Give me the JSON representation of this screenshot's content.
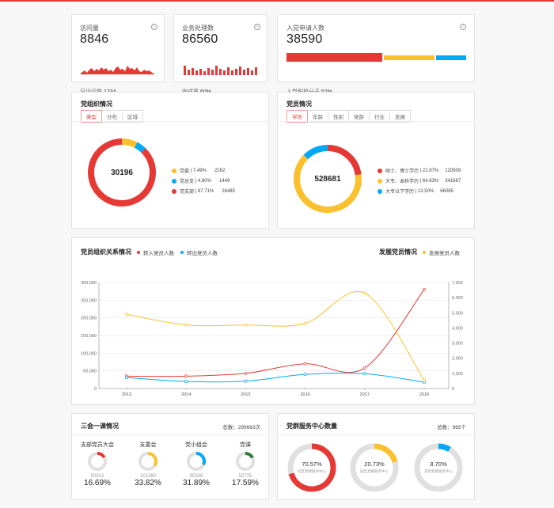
{
  "colors": {
    "red": "#e53935",
    "yellow": "#fbc02d",
    "blue": "#03a9f4",
    "green": "#2e7d32",
    "gray": "#e0e0e0"
  },
  "visits": {
    "label": "访问量",
    "value": "8846",
    "sub_label": "日访问量",
    "sub_value": "1234"
  },
  "business": {
    "label": "业务处理数",
    "value": "86560",
    "sub_label": "完成率",
    "sub_value": "60%"
  },
  "applicants": {
    "label": "入党申请人数",
    "value": "38590",
    "sub_label": "入党积极分子",
    "sub_value": "52%"
  },
  "org": {
    "title": "党组织情况",
    "tabs": [
      "类型",
      "分布",
      "区域"
    ],
    "center_value": "30196",
    "legend": [
      {
        "name": "党委",
        "pct": "7.49%",
        "count": "2262",
        "color": "#fbc02d",
        "frac": 0.0749
      },
      {
        "name": "党总支",
        "pct": "4.80%",
        "count": "1449",
        "color": "#03a9f4",
        "frac": 0.048
      },
      {
        "name": "党支部",
        "pct": "87.71%",
        "count": "26485",
        "color": "#e53935",
        "frac": 0.8771
      }
    ]
  },
  "members": {
    "title": "党员情况",
    "tabs": [
      "学历",
      "年龄",
      "性别",
      "党龄",
      "行业",
      "发展"
    ],
    "center_value": "528681",
    "legend": [
      {
        "name": "硕士、博士学历",
        "pct": "22.87%",
        "count": "120909",
        "color": "#e53935",
        "frac": 0.2287
      },
      {
        "name": "大专、本科学历",
        "pct": "64.63%",
        "count": "341687",
        "color": "#fbc02d",
        "frac": 0.6463
      },
      {
        "name": "大专以下学历",
        "pct": "12.50%",
        "count": "66085",
        "color": "#03a9f4",
        "frac": 0.125
      }
    ]
  },
  "relation": {
    "title": "党员组织关系情况",
    "legend_in": "转入党员人数",
    "legend_out": "转出党员人数",
    "dev_title": "发展党员情况",
    "legend_dev": "发展党员人数"
  },
  "chart_data": {
    "type": "line",
    "x": [
      "2013",
      "2014",
      "2015",
      "2016",
      "2017",
      "2018"
    ],
    "left_ticks": [
      "0",
      "50,000",
      "100,000",
      "150,000",
      "200,000",
      "250,000",
      "300,000"
    ],
    "right_ticks": [
      "0",
      "1,000",
      "2,000",
      "3,000",
      "4,000",
      "5,000",
      "6,000",
      "7,000"
    ],
    "ylim_left": [
      0,
      300000
    ],
    "ylim_right": [
      0,
      7000
    ],
    "series": [
      {
        "name": "转入党员人数",
        "axis": "left",
        "color": "#e53935",
        "values": [
          35000,
          35000,
          43000,
          70000,
          58000,
          280000
        ]
      },
      {
        "name": "转出党员人数",
        "axis": "left",
        "color": "#03a9f4",
        "values": [
          31000,
          20000,
          21000,
          40000,
          42000,
          18000
        ]
      },
      {
        "name": "发展党员人数",
        "axis": "right",
        "color": "#fbc02d",
        "values": [
          4900,
          4200,
          4200,
          4300,
          6300,
          550
        ]
      }
    ]
  },
  "meetings": {
    "title": "三会一课情况",
    "total_label": "总数：",
    "total_value": "299663次",
    "items": [
      {
        "name": "支部党员大会",
        "count": "50012",
        "pct": "16.69%",
        "frac": 0.1669,
        "color": "#e53935"
      },
      {
        "name": "支委会",
        "count": "101360",
        "pct": "33.82%",
        "frac": 0.3382,
        "color": "#fbc02d"
      },
      {
        "name": "党小组会",
        "count": "95566",
        "pct": "31.89%",
        "frac": 0.3189,
        "color": "#03a9f4"
      },
      {
        "name": "党课",
        "count": "52725",
        "pct": "17.59%",
        "frac": 0.1759,
        "color": "#2e7d32"
      }
    ]
  },
  "centers": {
    "title": "党群服务中心数量",
    "total_label": "总数：",
    "total_value": "965个",
    "items": [
      {
        "pct": "70.57%",
        "name": "社区党群服务中心",
        "frac": 0.7057,
        "color": "#e53935"
      },
      {
        "pct": "20.73%",
        "name": "园区党群服务中心",
        "frac": 0.2073,
        "color": "#fbc02d"
      },
      {
        "pct": "8.70%",
        "name": "其他党群服务中心",
        "frac": 0.087,
        "color": "#03a9f4"
      }
    ]
  }
}
